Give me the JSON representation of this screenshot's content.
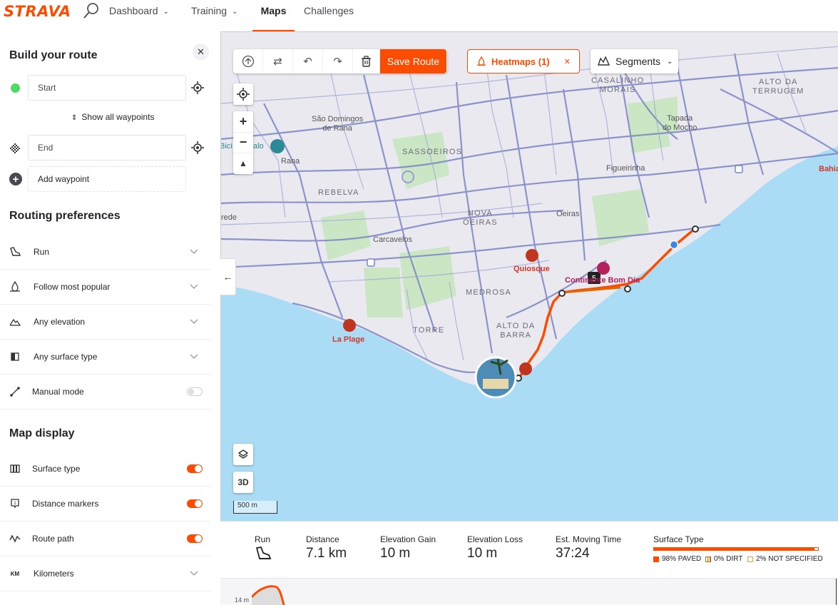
{
  "nav": {
    "logo": "STRAVA",
    "items": [
      {
        "label": "Dashboard",
        "has_dropdown": true
      },
      {
        "label": "Training",
        "has_dropdown": true
      },
      {
        "label": "Maps",
        "has_dropdown": false,
        "active": true
      },
      {
        "label": "Challenges",
        "has_dropdown": false
      }
    ]
  },
  "sidebar": {
    "title": "Build your route",
    "start_placeholder": "Start",
    "show_waypoints": "Show all waypoints",
    "end_placeholder": "End",
    "add_waypoint": "Add waypoint",
    "routing_title": "Routing preferences",
    "routing": [
      {
        "label": "Run",
        "icon": "shoe-icon"
      },
      {
        "label": "Follow most popular",
        "icon": "heatmap-icon"
      },
      {
        "label": "Any elevation",
        "icon": "mountain-icon"
      },
      {
        "label": "Any surface type",
        "icon": "surface-icon"
      },
      {
        "label": "Manual mode",
        "icon": "pen-path-icon",
        "toggle": false
      }
    ],
    "display_title": "Map display",
    "display": [
      {
        "label": "Surface type",
        "icon": "surface-type-icon",
        "toggle": true
      },
      {
        "label": "Distance markers",
        "icon": "marker-icon",
        "toggle": true
      },
      {
        "label": "Route path",
        "icon": "route-icon",
        "toggle": true
      },
      {
        "label": "Kilometers",
        "icon": "km-icon"
      }
    ],
    "km_icon_text": "KM"
  },
  "map": {
    "toolbar": {
      "save": "Save Route"
    },
    "heatmaps": "Heatmaps (1)",
    "segments": "Segments",
    "btn_3d": "3D",
    "scale": "500 m",
    "distance_marker": "5",
    "labels": {
      "casalinho": "CASALINHO\nMORAIS",
      "alto_terrugem": "ALTO DA\nTERRUGEM",
      "sao_domingos": "São Domingos\nde Rana",
      "tapada": "Tapada\ndo Mocho",
      "bicicalo": "Bici",
      "bicicalo2": "alo",
      "sassoeiros": "SASSOEIROS",
      "rana": "Rana",
      "figueirinha": "Figueirinha",
      "bahia": "Bahia",
      "rebelva": "REBELVA",
      "nova_oeiras": "NOVA\nOEIRAS",
      "oeiras": "Oeiras",
      "rede": "rede",
      "carcavelos": "Carcavelos",
      "quiosque": "Quiosque",
      "continente": "Continente Bom Dia",
      "medrosa": "MEDROSA",
      "alto_barra": "ALTO DA\nBARRA",
      "torre": "TORRE",
      "la_plage": "La Plage"
    }
  },
  "stats": {
    "activity_label": "Run",
    "distance_label": "Distance",
    "distance": "7.1 km",
    "gain_label": "Elevation Gain",
    "gain": "10 m",
    "loss_label": "Elevation Loss",
    "loss": "10 m",
    "time_label": "Est. Moving Time",
    "time": "37:24",
    "surface_label": "Surface Type",
    "surface_paved": 98,
    "paved": "98% PAVED",
    "dirt": "0% DIRT",
    "unspecified": "2% NOT SPECIFIED"
  },
  "elevation": {
    "tick": "14 m"
  },
  "colors": {
    "accent": "#fc4c02",
    "water": "#aadcf5",
    "road": "#7b86c4"
  }
}
